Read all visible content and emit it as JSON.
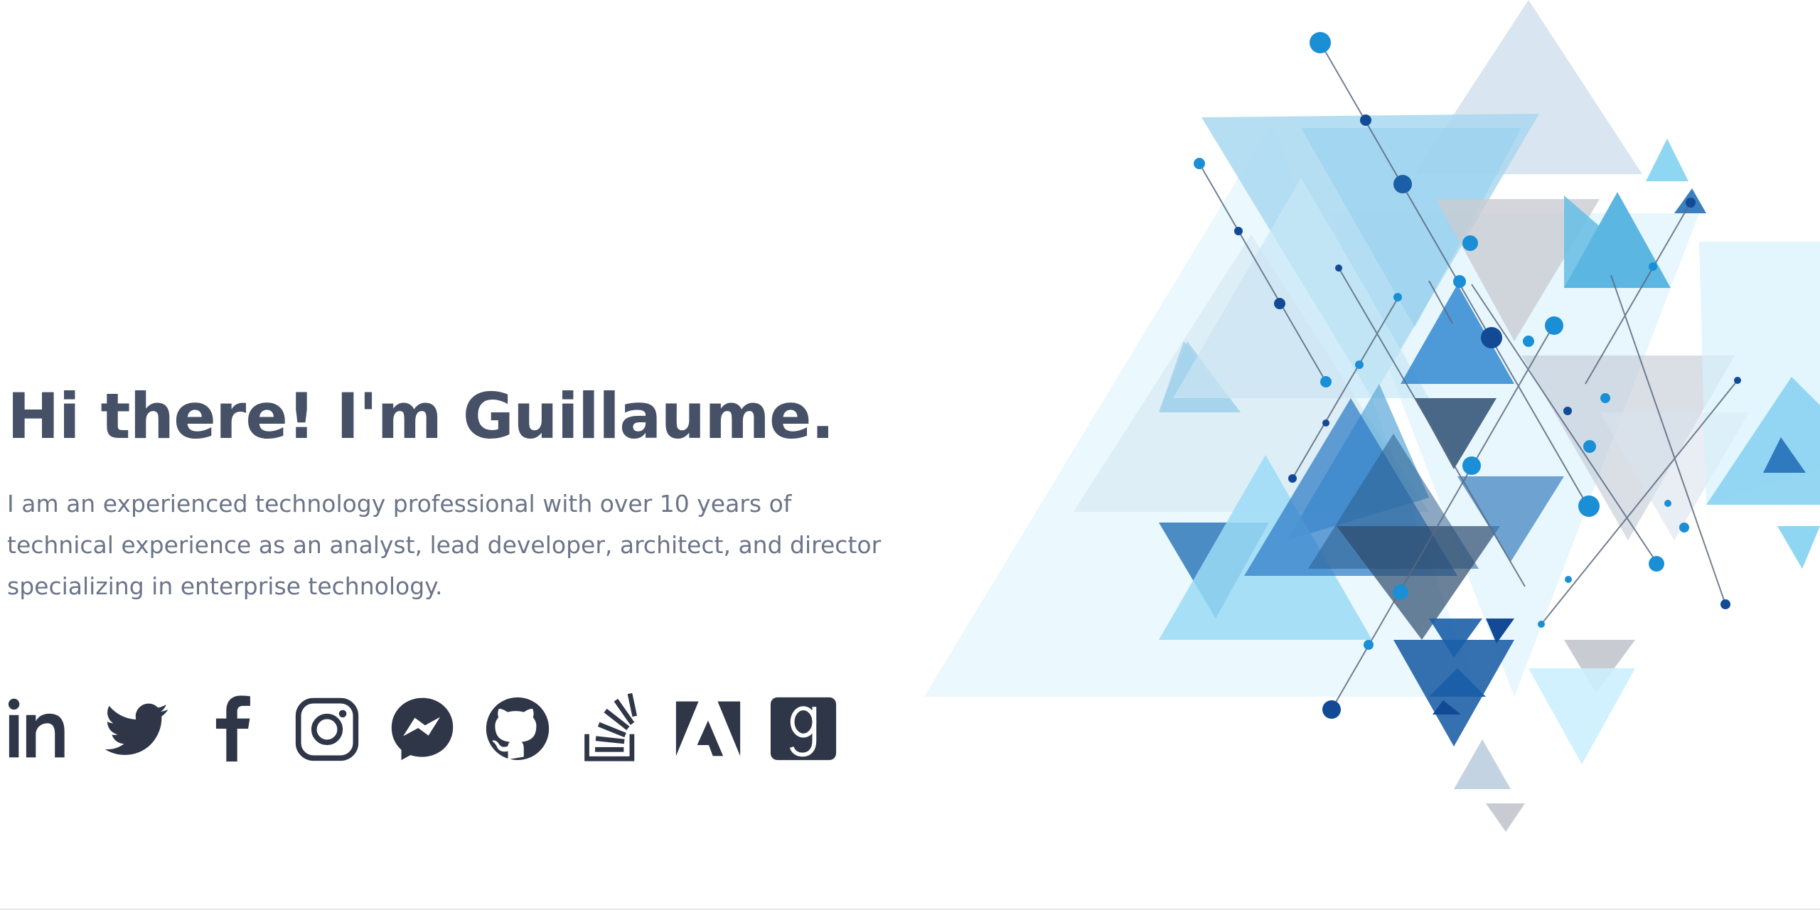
{
  "intro": {
    "heading": "Hi there! I'm Guillaume.",
    "bio": "I am an experienced technology professional with over 10 years of technical experience as an analyst, lead developer, architect, and director specializing in enterprise technology."
  },
  "social_links": [
    {
      "icon": "linkedin-icon"
    },
    {
      "icon": "twitter-icon"
    },
    {
      "icon": "facebook-icon"
    },
    {
      "icon": "instagram-icon"
    },
    {
      "icon": "messenger-icon"
    },
    {
      "icon": "github-icon"
    },
    {
      "icon": "stackoverflow-icon"
    },
    {
      "icon": "adobe-icon"
    },
    {
      "icon": "goodreads-icon"
    }
  ],
  "colors": {
    "heading": "#465167",
    "body_text": "#6b7488",
    "icons": "#2e3647",
    "accent_blue": "#1a8fd6",
    "dark_blue": "#1b5fa8",
    "light_blue": "#a8dcf5"
  }
}
